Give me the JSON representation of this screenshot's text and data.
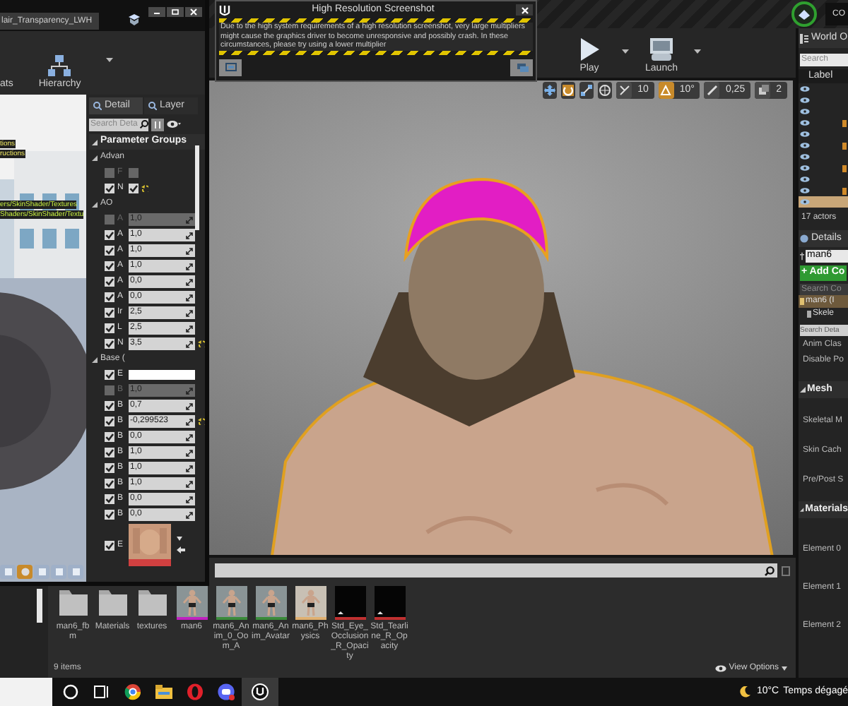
{
  "material_editor": {
    "tab": "lair_Transparency_LWH",
    "toolbar": [
      {
        "label": "ats"
      },
      {
        "label": "Hierarchy"
      }
    ],
    "preview": {
      "kind": "picture",
      "overlay_lines": [
        "tions",
        "ructions",
        "ers/SkinShader/Textures",
        "Shaders/SkinShader/Textu"
      ]
    },
    "panel_tabs": [
      {
        "label": "Detail",
        "selected": true
      },
      {
        "label": "Layer",
        "selected": false
      }
    ],
    "search": {
      "placeholder": "Search Deta"
    },
    "parameter_groups": {
      "title": "Parameter Groups",
      "groups": [
        {
          "name": "Advan",
          "rows": [
            {
              "kind": "toggle",
              "label": "F",
              "checked": false,
              "on": false,
              "reset": false
            },
            {
              "kind": "toggle",
              "label": "N",
              "checked": true,
              "on": true,
              "reset": true
            }
          ]
        },
        {
          "name": "AO",
          "rows": [
            {
              "kind": "scalar",
              "label": "A",
              "checked": false,
              "value": "1,0",
              "reset": false
            },
            {
              "kind": "scalar",
              "label": "A",
              "checked": true,
              "value": "1,0",
              "reset": false
            },
            {
              "kind": "scalar",
              "label": "A",
              "checked": true,
              "value": "1,0",
              "reset": false
            },
            {
              "kind": "scalar",
              "label": "A",
              "checked": true,
              "value": "1,0",
              "reset": false
            },
            {
              "kind": "scalar",
              "label": "A",
              "checked": true,
              "value": "0,0",
              "reset": false
            },
            {
              "kind": "scalar",
              "label": "A",
              "checked": true,
              "value": "0,0",
              "reset": false
            },
            {
              "kind": "scalar",
              "label": "Ir",
              "checked": true,
              "value": "2,5",
              "reset": false
            },
            {
              "kind": "scalar",
              "label": "L",
              "checked": true,
              "value": "2,5",
              "reset": false
            },
            {
              "kind": "scalar",
              "label": "N",
              "checked": true,
              "value": "3,5",
              "reset": true
            }
          ]
        },
        {
          "name": "Base (",
          "rows": [
            {
              "kind": "color",
              "label": "E",
              "checked": true,
              "reset": false
            },
            {
              "kind": "scalar",
              "label": "B",
              "checked": false,
              "value": "1,0",
              "reset": false
            },
            {
              "kind": "scalar",
              "label": "B",
              "checked": true,
              "value": "0,7",
              "reset": false
            },
            {
              "kind": "scalar",
              "label": "B",
              "checked": true,
              "value": "-0,299523",
              "reset": true
            },
            {
              "kind": "scalar",
              "label": "B",
              "checked": true,
              "value": "0,0",
              "reset": false
            },
            {
              "kind": "scalar",
              "label": "B",
              "checked": true,
              "value": "1,0",
              "reset": false
            },
            {
              "kind": "scalar",
              "label": "B",
              "checked": true,
              "value": "1,0",
              "reset": false
            },
            {
              "kind": "scalar",
              "label": "B",
              "checked": true,
              "value": "1,0",
              "reset": false
            },
            {
              "kind": "scalar",
              "label": "B",
              "checked": true,
              "value": "0,0",
              "reset": false
            },
            {
              "kind": "scalar",
              "label": "B",
              "checked": true,
              "value": "0,0",
              "reset": false
            },
            {
              "kind": "texture",
              "label": "E",
              "checked": true,
              "reset": false
            }
          ]
        }
      ]
    }
  },
  "dialog": {
    "title": "High Resolution Screenshot",
    "message": "Due to the high system requirements of a high resolution screenshot, very large multipliers might cause the graphics driver to become unresponsive and possibly crash. In these circumstances, please try using a lower multiplier"
  },
  "top_tab": {
    "label": "CO"
  },
  "toolbar": [
    {
      "label": "Play"
    },
    {
      "label": "Launch"
    }
  ],
  "viewport": {
    "kind": "picture",
    "snaps": [
      {
        "value": "10",
        "active": false
      },
      {
        "value": "10°",
        "active": true
      },
      {
        "value": "0,25",
        "active": false
      },
      {
        "value": "2",
        "active": false
      }
    ]
  },
  "world_outliner": {
    "title": "World O",
    "search": {
      "placeholder": "Search"
    },
    "column": "Label",
    "rows": [
      {
        "selected": false
      },
      {
        "selected": false
      },
      {
        "selected": false
      },
      {
        "selected": false
      },
      {
        "selected": false
      },
      {
        "selected": false
      },
      {
        "selected": false
      },
      {
        "selected": false
      },
      {
        "selected": false
      },
      {
        "selected": false
      },
      {
        "selected": true
      }
    ],
    "count": "17 actors"
  },
  "details": {
    "title": "Details",
    "name": "man6",
    "add_button": "+ Add Co",
    "component_search": {
      "placeholder": "Search Co"
    },
    "components": [
      {
        "label": "man6 (I",
        "selected": true
      },
      {
        "label": "Skele",
        "selected": false
      }
    ],
    "search": {
      "placeholder": "Search Deta"
    },
    "properties": [
      "Anim Clas",
      "Disable Po"
    ],
    "sections": [
      {
        "title": "Mesh",
        "items": [
          "Skeletal M",
          "Skin Cach",
          "Pre/Post S"
        ]
      },
      {
        "title": "Materials",
        "items": [
          "Element 0",
          "Element 1",
          "Element 2"
        ]
      }
    ]
  },
  "content_browser": {
    "items": [
      {
        "kind": "folder",
        "label": "man6_fbm"
      },
      {
        "kind": "folder",
        "label": "Materials"
      },
      {
        "kind": "folder",
        "label": "textures"
      },
      {
        "kind": "mesh",
        "label": "man6",
        "color": "#c020c0"
      },
      {
        "kind": "mesh",
        "label": "man6_Anim_0_Oom_A",
        "color": "#3a8a3a"
      },
      {
        "kind": "mesh",
        "label": "man6_Anim_Avatar",
        "color": "#3a8a3a"
      },
      {
        "kind": "mesh",
        "label": "man6_Physics",
        "color": "#e0b070"
      },
      {
        "kind": "texture",
        "label": "Std_Eye_Occlusion_R_Opacity",
        "color": "#c03030"
      },
      {
        "kind": "texture",
        "label": "Std_Tearline_R_Opacity",
        "color": "#c03030"
      }
    ],
    "count": "9 items",
    "view_options": "View Options"
  },
  "taskbar": {
    "temperature": "10°C",
    "weather": "Temps dégagé"
  }
}
